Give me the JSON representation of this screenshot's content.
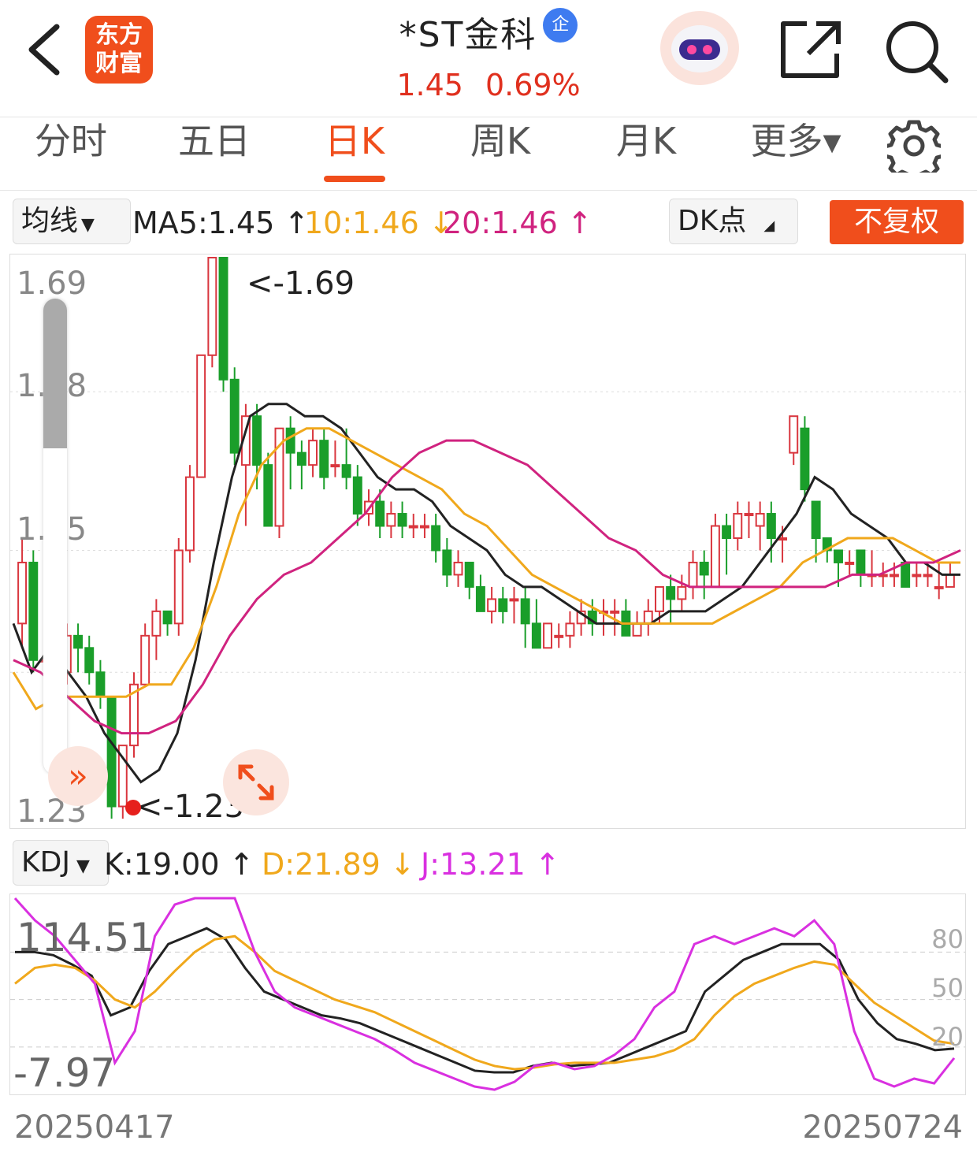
{
  "header": {
    "logo_line1": "东方",
    "logo_line2": "财富",
    "stock_name": "*ST金科",
    "badge": "企",
    "price": "1.45",
    "change_pct": "0.69%"
  },
  "icons": {
    "back": "chevron-left-icon",
    "robot": "robot-assistant-icon",
    "share": "share-icon",
    "search": "search-icon",
    "settings": "gear-icon"
  },
  "tabs": [
    {
      "label": "分时"
    },
    {
      "label": "五日"
    },
    {
      "label": "日K"
    },
    {
      "label": "周K"
    },
    {
      "label": "月K"
    },
    {
      "label": "更多▾"
    }
  ],
  "active_tab": "日K",
  "ma_row": {
    "selector": "均线",
    "ma5": "MA5:1.45 ↑",
    "ma10": "10:1.46 ↓",
    "ma20": "20:1.46 ↑",
    "dk": "DK点",
    "fuquan": "不复权"
  },
  "kdj_row": {
    "selector": "KDJ",
    "k": "K:19.00 ↑",
    "d": "D:21.89 ↓",
    "j": "J:13.21 ↑"
  },
  "colors": {
    "up": "#d9363e",
    "down": "#1a9e2a",
    "ma5": "#222222",
    "ma10": "#f0a81c",
    "ma20": "#d0237f",
    "k": "#222222",
    "d": "#f0a81c",
    "j": "#d930e0",
    "accent": "#f04e1c"
  },
  "chart_data": [
    {
      "type": "candlestick",
      "y_ticks": [
        "1.69",
        "1.58",
        "1.45",
        "1.23"
      ],
      "ylim": [
        1.23,
        1.69
      ],
      "max_label": "<-1.69",
      "min_label": "<-1.23",
      "candles": [
        [
          1.39,
          1.44,
          1.37,
          1.46
        ],
        [
          1.44,
          1.36,
          1.35,
          1.45
        ],
        [
          1.36,
          1.36,
          1.34,
          1.37
        ],
        [
          1.36,
          1.34,
          1.33,
          1.38
        ],
        [
          1.35,
          1.38,
          1.34,
          1.39
        ],
        [
          1.38,
          1.37,
          1.35,
          1.39
        ],
        [
          1.37,
          1.35,
          1.34,
          1.38
        ],
        [
          1.35,
          1.33,
          1.32,
          1.36
        ],
        [
          1.33,
          1.24,
          1.23,
          1.33
        ],
        [
          1.24,
          1.29,
          1.23,
          1.29
        ],
        [
          1.29,
          1.34,
          1.28,
          1.35
        ],
        [
          1.34,
          1.38,
          1.34,
          1.39
        ],
        [
          1.38,
          1.4,
          1.36,
          1.41
        ],
        [
          1.4,
          1.39,
          1.38,
          1.4
        ],
        [
          1.39,
          1.45,
          1.38,
          1.46
        ],
        [
          1.45,
          1.51,
          1.44,
          1.52
        ],
        [
          1.51,
          1.61,
          1.51,
          1.61
        ],
        [
          1.61,
          1.69,
          1.6,
          1.69
        ],
        [
          1.69,
          1.59,
          1.58,
          1.69
        ],
        [
          1.59,
          1.53,
          1.52,
          1.6
        ],
        [
          1.52,
          1.56,
          1.47,
          1.57
        ],
        [
          1.56,
          1.52,
          1.5,
          1.57
        ],
        [
          1.52,
          1.47,
          1.47,
          1.53
        ],
        [
          1.47,
          1.55,
          1.46,
          1.55
        ],
        [
          1.55,
          1.53,
          1.5,
          1.56
        ],
        [
          1.53,
          1.52,
          1.5,
          1.54
        ],
        [
          1.52,
          1.54,
          1.51,
          1.55
        ],
        [
          1.54,
          1.51,
          1.5,
          1.55
        ],
        [
          1.52,
          1.52,
          1.51,
          1.54
        ],
        [
          1.52,
          1.51,
          1.5,
          1.55
        ],
        [
          1.51,
          1.48,
          1.47,
          1.52
        ],
        [
          1.48,
          1.49,
          1.47,
          1.5
        ],
        [
          1.49,
          1.47,
          1.46,
          1.5
        ],
        [
          1.47,
          1.48,
          1.46,
          1.49
        ],
        [
          1.48,
          1.47,
          1.46,
          1.49
        ],
        [
          1.47,
          1.47,
          1.46,
          1.48
        ],
        [
          1.47,
          1.47,
          1.46,
          1.48
        ],
        [
          1.47,
          1.45,
          1.44,
          1.48
        ],
        [
          1.45,
          1.43,
          1.42,
          1.46
        ],
        [
          1.43,
          1.44,
          1.42,
          1.45
        ],
        [
          1.44,
          1.42,
          1.41,
          1.44
        ],
        [
          1.42,
          1.4,
          1.4,
          1.43
        ],
        [
          1.4,
          1.41,
          1.39,
          1.42
        ],
        [
          1.41,
          1.4,
          1.39,
          1.42
        ],
        [
          1.41,
          1.41,
          1.39,
          1.42
        ],
        [
          1.41,
          1.39,
          1.37,
          1.42
        ],
        [
          1.39,
          1.37,
          1.37,
          1.41
        ],
        [
          1.37,
          1.39,
          1.37,
          1.39
        ],
        [
          1.38,
          1.38,
          1.37,
          1.39
        ],
        [
          1.38,
          1.39,
          1.37,
          1.4
        ],
        [
          1.39,
          1.4,
          1.38,
          1.41
        ],
        [
          1.4,
          1.39,
          1.38,
          1.41
        ],
        [
          1.4,
          1.4,
          1.38,
          1.41
        ],
        [
          1.4,
          1.4,
          1.38,
          1.41
        ],
        [
          1.4,
          1.38,
          1.38,
          1.41
        ],
        [
          1.38,
          1.39,
          1.38,
          1.4
        ],
        [
          1.39,
          1.4,
          1.38,
          1.41
        ],
        [
          1.4,
          1.42,
          1.39,
          1.42
        ],
        [
          1.42,
          1.41,
          1.39,
          1.43
        ],
        [
          1.41,
          1.42,
          1.4,
          1.43
        ],
        [
          1.42,
          1.44,
          1.41,
          1.45
        ],
        [
          1.44,
          1.43,
          1.41,
          1.45
        ],
        [
          1.42,
          1.47,
          1.42,
          1.48
        ],
        [
          1.47,
          1.46,
          1.43,
          1.48
        ],
        [
          1.46,
          1.48,
          1.45,
          1.49
        ],
        [
          1.48,
          1.48,
          1.46,
          1.49
        ],
        [
          1.47,
          1.48,
          1.45,
          1.49
        ],
        [
          1.48,
          1.46,
          1.44,
          1.49
        ],
        [
          1.46,
          1.46,
          1.44,
          1.47
        ],
        [
          1.53,
          1.56,
          1.52,
          1.56
        ],
        [
          1.55,
          1.5,
          1.49,
          1.56
        ],
        [
          1.49,
          1.46,
          1.44,
          1.49
        ],
        [
          1.46,
          1.45,
          1.44,
          1.46
        ],
        [
          1.45,
          1.44,
          1.42,
          1.45
        ],
        [
          1.44,
          1.44,
          1.43,
          1.45
        ],
        [
          1.45,
          1.43,
          1.42,
          1.45
        ],
        [
          1.43,
          1.43,
          1.42,
          1.45
        ],
        [
          1.43,
          1.43,
          1.42,
          1.44
        ],
        [
          1.43,
          1.43,
          1.42,
          1.44
        ],
        [
          1.44,
          1.42,
          1.42,
          1.44
        ],
        [
          1.43,
          1.43,
          1.42,
          1.44
        ],
        [
          1.43,
          1.43,
          1.42,
          1.44
        ],
        [
          1.42,
          1.42,
          1.41,
          1.44
        ],
        [
          1.42,
          1.43,
          1.42,
          1.44
        ]
      ],
      "ma5": [
        1.39,
        1.35,
        1.37,
        1.35,
        1.33,
        1.3,
        1.28,
        1.26,
        1.27,
        1.3,
        1.36,
        1.44,
        1.51,
        1.56,
        1.57,
        1.57,
        1.56,
        1.56,
        1.55,
        1.53,
        1.51,
        1.5,
        1.5,
        1.49,
        1.47,
        1.46,
        1.45,
        1.43,
        1.42,
        1.42,
        1.41,
        1.4,
        1.39,
        1.39,
        1.39,
        1.39,
        1.4,
        1.4,
        1.4,
        1.41,
        1.42,
        1.44,
        1.46,
        1.48,
        1.51,
        1.5,
        1.48,
        1.47,
        1.46,
        1.44,
        1.44,
        1.43,
        1.43
      ],
      "ma10": [
        1.35,
        1.32,
        1.33,
        1.33,
        1.33,
        1.33,
        1.34,
        1.34,
        1.37,
        1.42,
        1.48,
        1.52,
        1.54,
        1.55,
        1.55,
        1.54,
        1.53,
        1.52,
        1.51,
        1.5,
        1.48,
        1.47,
        1.45,
        1.43,
        1.42,
        1.41,
        1.4,
        1.39,
        1.39,
        1.39,
        1.39,
        1.39,
        1.4,
        1.41,
        1.42,
        1.44,
        1.45,
        1.46,
        1.46,
        1.46,
        1.45,
        1.44,
        1.44
      ],
      "ma20": [
        1.36,
        1.35,
        1.33,
        1.31,
        1.3,
        1.3,
        1.31,
        1.34,
        1.38,
        1.41,
        1.43,
        1.44,
        1.46,
        1.48,
        1.51,
        1.53,
        1.54,
        1.54,
        1.53,
        1.52,
        1.5,
        1.48,
        1.46,
        1.45,
        1.43,
        1.42,
        1.42,
        1.42,
        1.42,
        1.42,
        1.42,
        1.43,
        1.43,
        1.44,
        1.44,
        1.45
      ]
    },
    {
      "type": "line",
      "title": "KDJ",
      "y_ticks_right": [
        "80",
        "50",
        "20"
      ],
      "max_label": "114.51",
      "min_label": "-7.97",
      "ylim": [
        -7.97,
        114.51
      ],
      "x_start_label": "20250417",
      "x_end_label": "20250724",
      "series": [
        {
          "name": "K",
          "values": [
            80,
            80,
            78,
            72,
            65,
            40,
            45,
            68,
            85,
            90,
            95,
            88,
            70,
            55,
            50,
            45,
            40,
            38,
            35,
            30,
            25,
            20,
            15,
            10,
            5,
            4,
            4,
            8,
            10,
            8,
            9,
            10,
            15,
            20,
            25,
            30,
            55,
            65,
            75,
            80,
            85,
            85,
            85,
            75,
            50,
            35,
            25,
            22,
            18,
            19
          ]
        },
        {
          "name": "D",
          "values": [
            60,
            70,
            72,
            70,
            62,
            50,
            45,
            55,
            68,
            80,
            88,
            90,
            80,
            68,
            62,
            56,
            50,
            46,
            42,
            36,
            30,
            24,
            18,
            12,
            8,
            6,
            7,
            9,
            10,
            10,
            10,
            12,
            14,
            18,
            25,
            40,
            52,
            60,
            65,
            70,
            74,
            72,
            60,
            48,
            40,
            32,
            24,
            22
          ]
        },
        {
          "name": "J",
          "values": [
            114,
            100,
            90,
            75,
            60,
            10,
            30,
            90,
            110,
            114,
            114,
            114,
            80,
            55,
            45,
            40,
            35,
            30,
            25,
            18,
            10,
            5,
            0,
            -5,
            -7,
            -2,
            8,
            10,
            6,
            8,
            15,
            25,
            45,
            55,
            85,
            90,
            85,
            90,
            95,
            90,
            100,
            85,
            30,
            0,
            -5,
            0,
            -3,
            13
          ]
        }
      ]
    }
  ]
}
